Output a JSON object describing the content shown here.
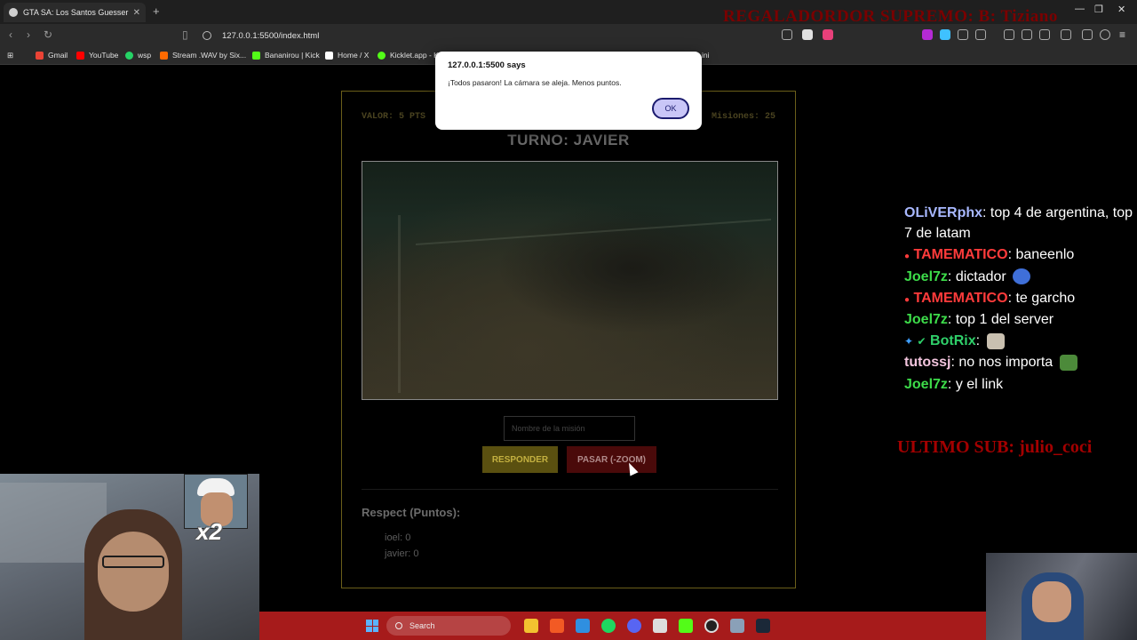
{
  "browser": {
    "tab_title": "GTA SA: Los Santos Guesser",
    "tab_close": "✕",
    "new_tab": "+",
    "url": "127.0.0.1:5500/index.html",
    "bookmarks": [
      {
        "label": "Gmail",
        "color": "#ea4335"
      },
      {
        "label": "YouTube",
        "color": "#ff0000"
      },
      {
        "label": "wsp",
        "color": "#25d366"
      },
      {
        "label": "Stream .WAV by Six...",
        "color": "#ff6a00"
      },
      {
        "label": "Bananirou | Kick",
        "color": "#53fc18"
      },
      {
        "label": "Home / X",
        "color": "#ffffff"
      },
      {
        "label": "Kicklet.app - K",
        "color": "#53fc18"
      },
      {
        "label": "ini",
        "color": "#888888"
      }
    ]
  },
  "overlay": {
    "top_banner": "REGALADORDOR SUPREMO: B: Tiziano",
    "last_sub": "ULTIMO SUB: julio_coci"
  },
  "game": {
    "valor": "VALOR: 5 PTS",
    "misiones": "Misiones: 25",
    "turno": "TURNO: JAVIER",
    "input_placeholder": "Nombre de la misión",
    "responder_label": "RESPONDER",
    "pasar_label": "PASAR (-ZOOM)",
    "respect_title": "Respect (Puntos):",
    "scores": [
      "ioel: 0",
      "javier: 0"
    ]
  },
  "alert": {
    "origin": "127.0.0.1:5500 says",
    "message": "¡Todos pasaron! La cámara se aleja. Menos puntos.",
    "ok_label": "OK"
  },
  "chat": [
    {
      "user": "OLiVERphx",
      "color": "#a8b8ff",
      "text": ": top 4 de argentina, top 7 de latam"
    },
    {
      "user": "TAMEMATICO",
      "color": "#ff3b3b",
      "text": ": baneenlo"
    },
    {
      "user": "Joel7z",
      "color": "#3ddc4a",
      "text": ": dictador"
    },
    {
      "user": "TAMEMATICO",
      "color": "#ff3b3b",
      "text": ": te garcho"
    },
    {
      "user": "Joel7z",
      "color": "#3ddc4a",
      "text": ": top 1 del server"
    },
    {
      "user": "BotRix",
      "color": "#2fd06a",
      "text": ":"
    },
    {
      "user": "tutossj",
      "color": "#f2c4dd",
      "text": ": no nos importa"
    },
    {
      "user": "Joel7z",
      "color": "#3ddc4a",
      "text": ": y el link"
    }
  ],
  "webcam": {
    "multiplier": "x2"
  },
  "taskbar": {
    "search_label": "Search"
  }
}
